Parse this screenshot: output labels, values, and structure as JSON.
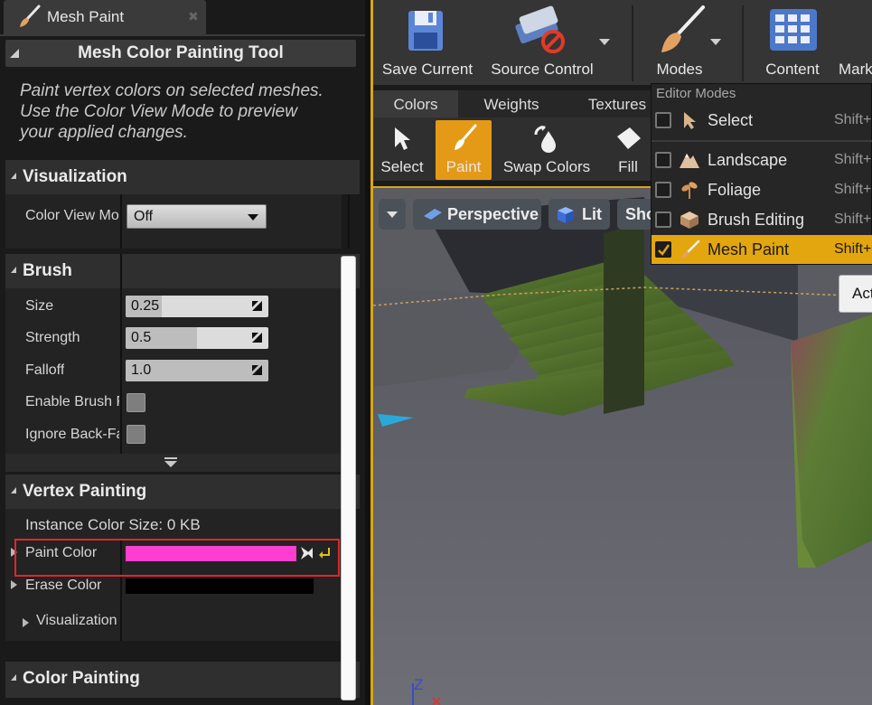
{
  "panel": {
    "tab_title": "Mesh Paint",
    "tool_title": "Mesh Color Painting Tool",
    "description_lines": [
      "Paint vertex colors on selected meshes.",
      "Use the Color View Mode to preview",
      "your applied changes."
    ]
  },
  "visualization": {
    "title": "Visualization",
    "color_view_mode_label": "Color View Mo",
    "color_view_mode_value": "Off"
  },
  "brush": {
    "title": "Brush",
    "size_label": "Size",
    "size_value": "0.25",
    "size_fill": 0.25,
    "strength_label": "Strength",
    "strength_value": "0.5",
    "strength_fill": 0.5,
    "falloff_label": "Falloff",
    "falloff_value": "1.0",
    "falloff_fill": 1.0,
    "enable_brush_label": "Enable Brush F",
    "ignore_backface_label": "Ignore Back-Fa"
  },
  "vertex_painting": {
    "title": "Vertex Painting",
    "instance_color_size": "Instance Color Size: 0 KB",
    "paint_color_label": "Paint Color",
    "paint_color": "#ff3dd0",
    "erase_color_label": "Erase Color",
    "erase_color": "#000000",
    "visualization_label": "Visualization"
  },
  "color_painting": {
    "title": "Color Painting"
  },
  "toolbar": {
    "save_current": "Save Current",
    "source_control": "Source Control",
    "modes": "Modes",
    "content": "Content",
    "marketplace_partial": "Mark"
  },
  "mode_tabs": [
    "Colors",
    "Weights",
    "Textures"
  ],
  "mode_tools": {
    "select": "Select",
    "paint": "Paint",
    "swap_colors": "Swap Colors",
    "fill": "Fill"
  },
  "viewport": {
    "perspective": "Perspective",
    "lit": "Lit",
    "show_partial": "Sho",
    "axis_z": "Z",
    "actor_button_partial": "Act"
  },
  "editor_modes_menu": {
    "header": "Editor Modes",
    "items": [
      {
        "label": "Select",
        "shortcut": "Shift+",
        "checked": false,
        "icon": "arrow-cursor-icon"
      },
      {
        "label": "Landscape",
        "shortcut": "Shift+",
        "checked": false,
        "icon": "landscape-icon"
      },
      {
        "label": "Foliage",
        "shortcut": "Shift+",
        "checked": false,
        "icon": "foliage-icon"
      },
      {
        "label": "Brush Editing",
        "shortcut": "Shift+",
        "checked": false,
        "icon": "brush-editing-icon"
      },
      {
        "label": "Mesh Paint",
        "shortcut": "Shift+",
        "checked": true,
        "icon": "mesh-paint-brush-icon"
      }
    ]
  },
  "colors": {
    "accent": "#e3a60f",
    "highlight_box": "#e0262d",
    "panel_bg": "#1a1a1a"
  }
}
